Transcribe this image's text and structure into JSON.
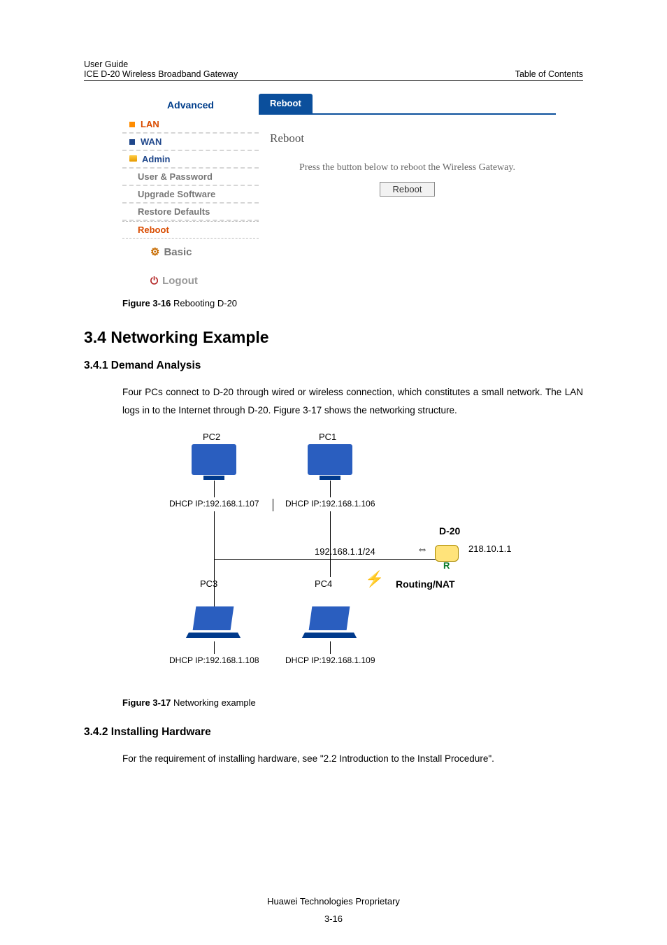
{
  "header": {
    "guide_line1": "User Guide",
    "guide_line2": "ICE D-20 Wireless Broadband Gateway",
    "right": "Table of Contents"
  },
  "sidebar": {
    "title": "Advanced",
    "items": {
      "lan": "LAN",
      "wan": "WAN",
      "admin": "Admin",
      "user_pass": "User & Password",
      "upgrade": "Upgrade Software",
      "restore": "Restore Defaults",
      "reboot": "Reboot",
      "basic": "Basic",
      "logout": "Logout"
    }
  },
  "pane": {
    "tab_title": "Reboot",
    "heading": "Reboot",
    "text": "Press the button below to reboot the Wireless Gateway.",
    "button": "Reboot"
  },
  "caption1": {
    "bold": "Figure 3-16",
    "rest": " Rebooting D-20"
  },
  "h2": "3.4  Networking Example",
  "h3_1": "3.4.1  Demand Analysis",
  "para1": "Four PCs connect to D-20 through wired or wireless connection, which constitutes a small network. The LAN logs in to the Internet through D-20. Figure 3-17 shows the networking structure.",
  "diagram": {
    "pc1": "PC1",
    "pc2": "PC2",
    "pc3": "PC3",
    "pc4": "PC4",
    "dhcp1": "DHCP IP:192.168.1.106",
    "dhcp2": "DHCP IP:192.168.1.107",
    "dhcp3": "DHCP IP:192.168.1.108",
    "dhcp4": "DHCP IP:192.168.1.109",
    "d20": "D-20",
    "lan_ip": "192.168.1.1/24",
    "wan_ip": "218.10.1.1",
    "routing": "Routing/NAT",
    "router_r": "R"
  },
  "caption2": {
    "bold": "Figure 3-17",
    "rest": " Networking example"
  },
  "h3_2": "3.4.2  Installing Hardware",
  "para2": "For the requirement of installing hardware, see \"2.2  Introduction to the Install Procedure\".",
  "footer": "Huawei Technologies Proprietary",
  "pagenum": "3-16"
}
